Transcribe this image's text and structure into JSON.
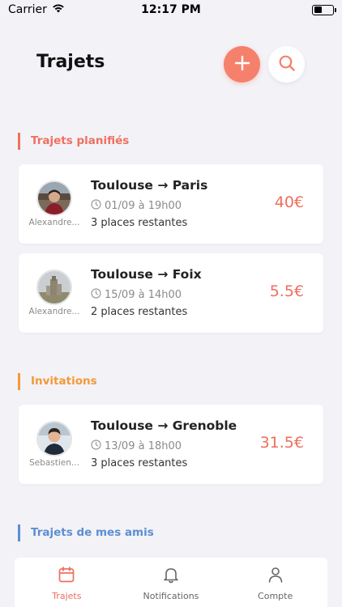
{
  "status_bar": {
    "carrier": "Carrier",
    "time": "12:17 PM"
  },
  "header": {
    "title": "Trajets",
    "add_icon": "plus-icon",
    "search_icon": "search-icon"
  },
  "sections": {
    "planned": {
      "title": "Trajets planifiés",
      "color": "#f0705f"
    },
    "invitations": {
      "title": "Invitations",
      "color": "#f29a36"
    },
    "friends": {
      "title": "Trajets de mes amis",
      "color": "#5b8fd1"
    }
  },
  "planned_trips": [
    {
      "driver": "Alexandre...",
      "route": "Toulouse → Paris",
      "date": "01/09 à 19h00",
      "seats": "3 places restantes",
      "price": "40€"
    },
    {
      "driver": "Alexandre...",
      "route": "Toulouse → Foix",
      "date": "15/09 à 14h00",
      "seats": "2 places restantes",
      "price": "5.5€"
    }
  ],
  "invitation_trips": [
    {
      "driver": "Sebastien...",
      "route": "Toulouse → Grenoble",
      "date": "13/09 à 18h00",
      "seats": "3 places restantes",
      "price": "31.5€"
    }
  ],
  "tab_bar": {
    "tabs": [
      {
        "label": "Trajets",
        "icon": "calendar-icon",
        "active": true
      },
      {
        "label": "Notifications",
        "icon": "bell-icon",
        "active": false
      },
      {
        "label": "Compte",
        "icon": "user-icon",
        "active": false
      }
    ]
  },
  "colors": {
    "accent": "#f5816c",
    "price": "#ee6f5d",
    "background": "#f3f2f7"
  }
}
